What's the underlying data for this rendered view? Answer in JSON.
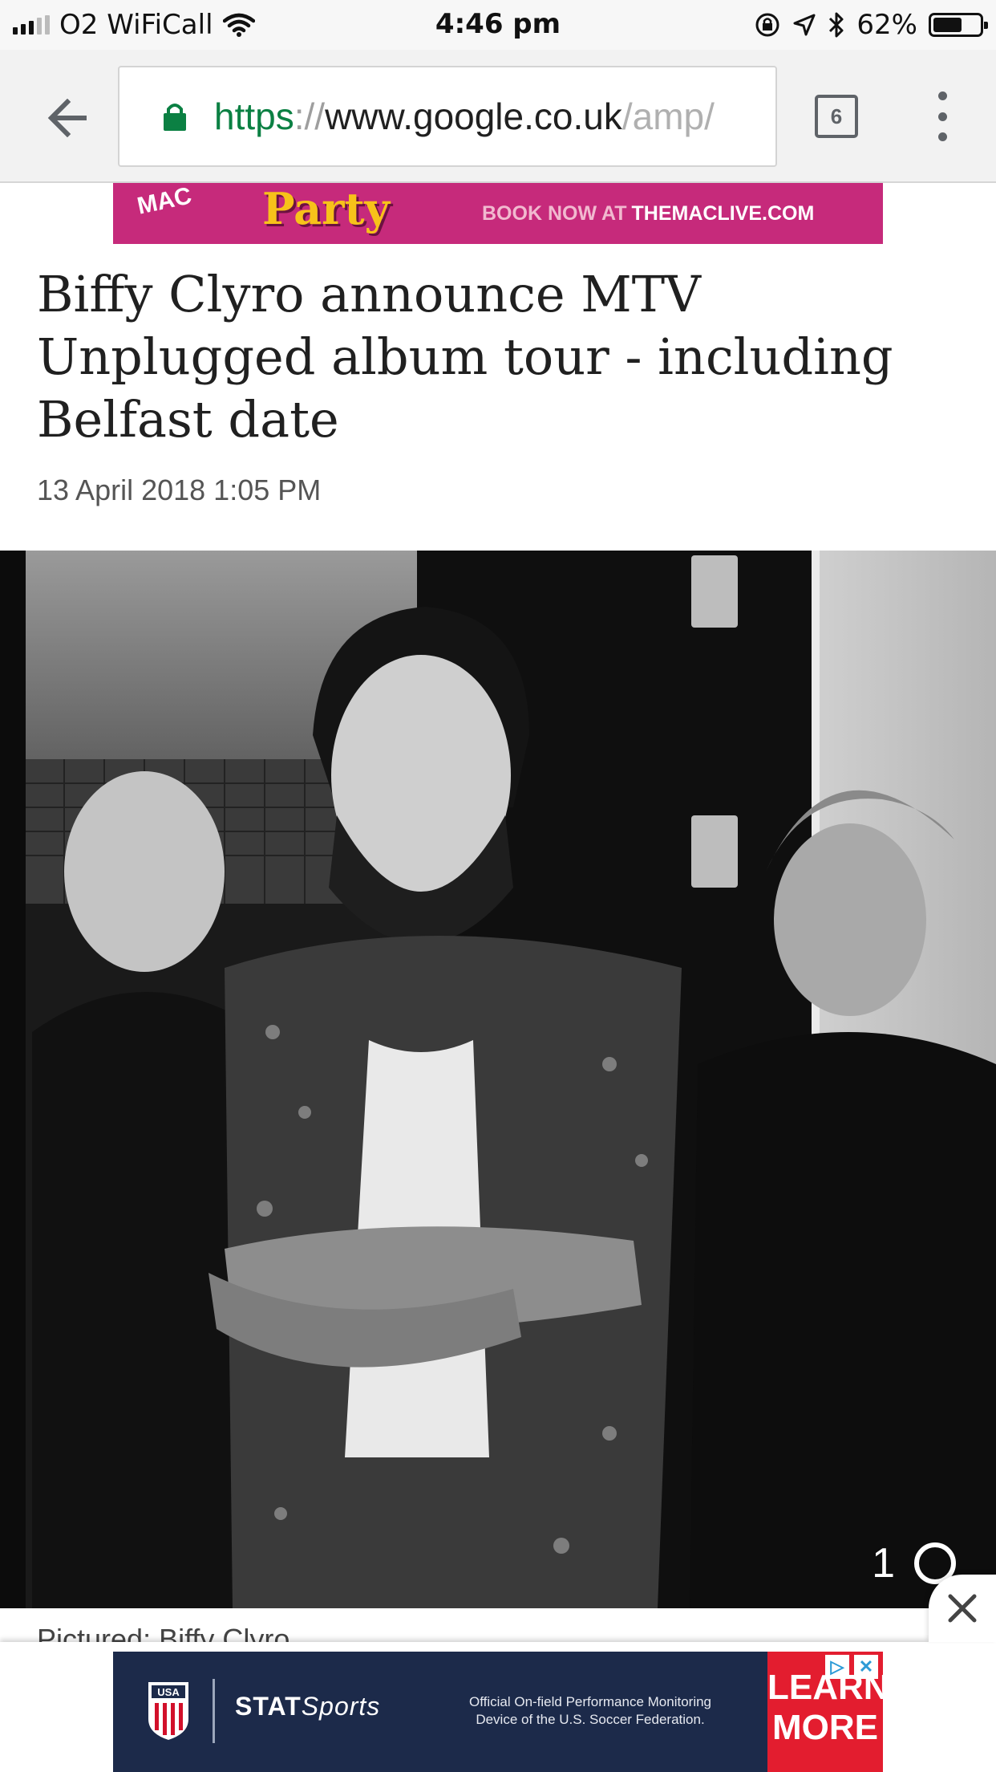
{
  "status_bar": {
    "carrier": "O2 WiFiCall",
    "time": "4:46 pm",
    "battery_percent": "62%",
    "battery_level": 0.62
  },
  "browser": {
    "url_scheme": "https",
    "url_separator": "://",
    "url_host": "www.google.co.uk",
    "url_path": "/amp/",
    "tab_count": "6"
  },
  "top_ad": {
    "logo_text": "MAC",
    "headline": "Party",
    "cta_prefix": "BOOK NOW AT",
    "cta_site": "THEMACLIVE.COM"
  },
  "article": {
    "headline": "Biffy Clyro announce MTV Unplugged album tour - including Belfast date",
    "date": "13 April 2018 1:05 PM",
    "photo_index": "1",
    "caption": "Pictured: Biffy Clyro"
  },
  "bottom_ad": {
    "crest_text": "USA",
    "brand_prefix": "STAT",
    "brand_suffix": "Sports",
    "copy": "Official On-field Performance Monitoring Device of the U.S. Soccer Federation.",
    "cta_line1": "LEARN",
    "cta_line2": "MORE"
  },
  "colors": {
    "url_green": "#0b8043",
    "top_ad_bg": "#c62a7b",
    "top_ad_gold": "#f7c21a",
    "bottom_ad_bg": "#1c2a4a",
    "cta_red": "#e31d2f"
  }
}
